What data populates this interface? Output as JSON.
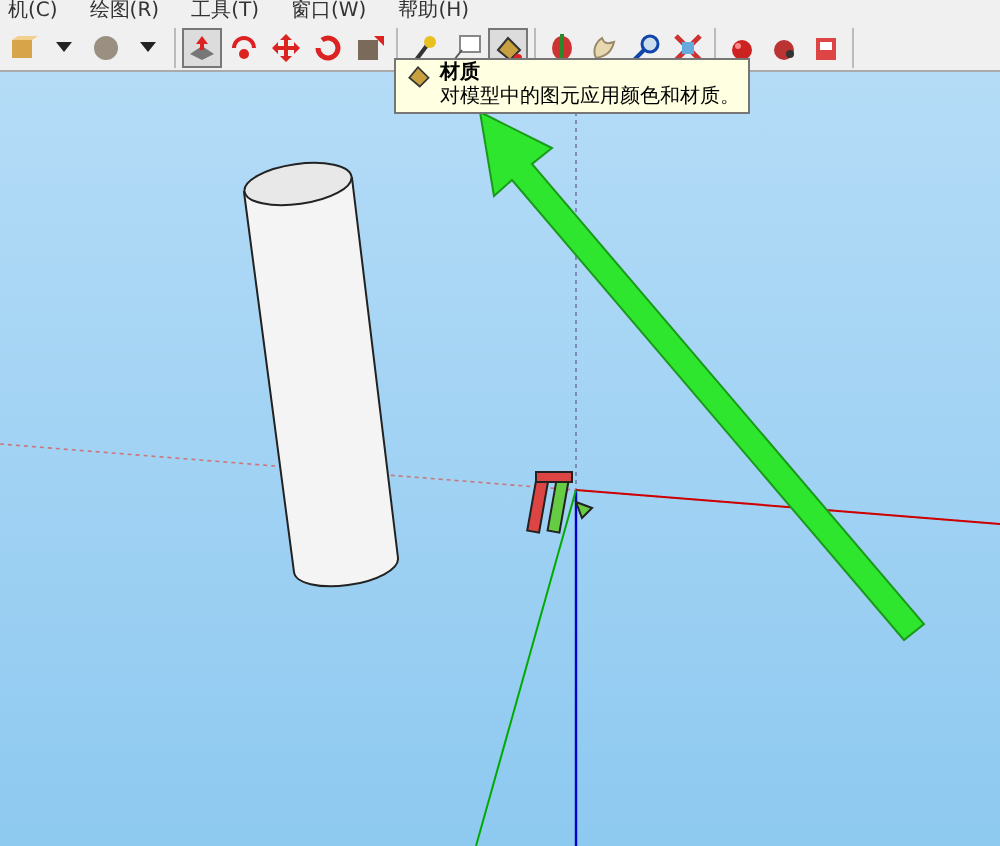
{
  "menu_bar": {
    "items": [
      {
        "label": "机(C)"
      },
      {
        "label": "绘图(R)"
      },
      {
        "label": "工具(T)"
      },
      {
        "label": "窗口(W)"
      },
      {
        "label": "帮助(H)"
      }
    ]
  },
  "toolbar": {
    "groups": [
      {
        "tools": [
          {
            "selected": false
          },
          {
            "selected": false
          },
          {
            "selected": false
          },
          {
            "selected": false
          }
        ]
      },
      {
        "tools": [
          {
            "selected": true
          },
          {
            "selected": false
          },
          {
            "selected": false
          },
          {
            "selected": false
          },
          {
            "selected": false
          }
        ]
      },
      {
        "tools": [
          {
            "selected": false
          },
          {
            "selected": false
          },
          {
            "selected": true
          }
        ]
      },
      {
        "tools": [
          {
            "selected": false
          },
          {
            "selected": false
          },
          {
            "selected": false
          },
          {
            "selected": false
          }
        ]
      },
      {
        "tools": [
          {
            "selected": false
          },
          {
            "selected": false
          },
          {
            "selected": false
          }
        ]
      }
    ]
  },
  "tooltip": {
    "title": "材质",
    "description": "对模型中的图元应用颜色和材质。"
  }
}
